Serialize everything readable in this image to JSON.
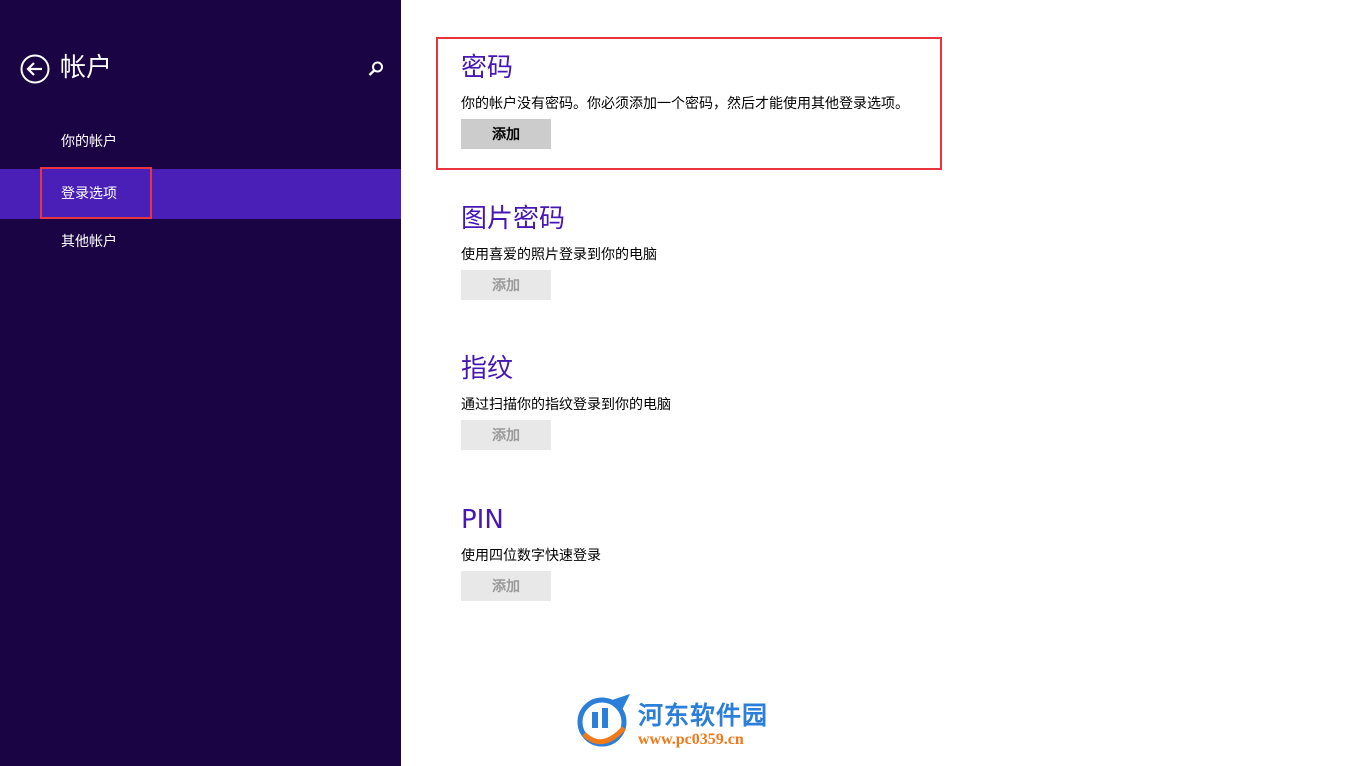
{
  "sidebar": {
    "title": "帐户",
    "back_icon": "arrow-left-circle-icon",
    "search_icon": "search-icon",
    "items": [
      {
        "label": "你的帐户",
        "active": false
      },
      {
        "label": "登录选项",
        "active": true
      },
      {
        "label": "其他帐户",
        "active": false
      }
    ]
  },
  "main": {
    "sections": [
      {
        "title": "密码",
        "description": "你的帐户没有密码。你必须添加一个密码，然后才能使用其他登录选项。",
        "button_label": "添加",
        "button_enabled": true
      },
      {
        "title": "图片密码",
        "description": "使用喜爱的照片登录到你的电脑",
        "button_label": "添加",
        "button_enabled": false
      },
      {
        "title": "指纹",
        "description": "通过扫描你的指纹登录到你的电脑",
        "button_label": "添加",
        "button_enabled": false
      },
      {
        "title": "PIN",
        "description": "使用四位数字快速登录",
        "button_label": "添加",
        "button_enabled": false
      }
    ]
  },
  "watermark": {
    "name": "河东软件园",
    "url": "www.pc0359.cn"
  },
  "colors": {
    "sidebar_bg": "#1b0444",
    "active_item_bg": "#4a1fb8",
    "section_title": "#4617b4",
    "highlight_border": "#e7343f"
  }
}
